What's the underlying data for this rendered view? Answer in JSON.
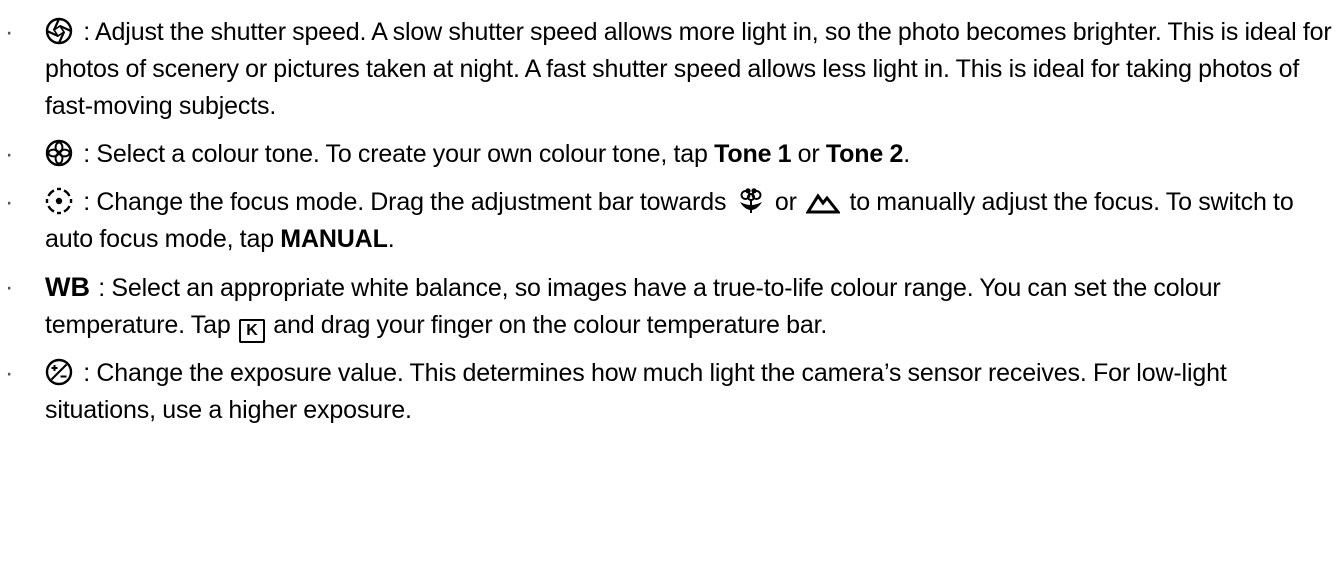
{
  "items": [
    {
      "icon": "shutter-speed-icon",
      "text": " : Adjust the shutter speed. A slow shutter speed allows more light in, so the photo becomes brighter. This is ideal for photos of scenery or pictures taken at night. A fast shutter speed allows less light in. This is ideal for taking photos of fast-moving subjects."
    },
    {
      "icon": "colour-tone-icon",
      "text_a": " : Select a colour tone. To create your own colour tone, tap ",
      "bold_a": "Tone 1",
      "text_b": " or ",
      "bold_b": "Tone 2",
      "text_c": "."
    },
    {
      "icon": "focus-mode-icon",
      "text_a": " : Change the focus mode. Drag the adjustment bar towards ",
      "macro_icon": "macro-flower-icon",
      "text_b": " or ",
      "landscape_icon": "mountain-icon",
      "text_c": " to manually adjust the focus. To switch to auto focus mode, tap ",
      "bold_a": "MANUAL",
      "text_d": "."
    },
    {
      "icon_label": "WB",
      "text_a": " : Select an appropriate white balance, so images have a true-to-life colour range. You can set the colour temperature. Tap ",
      "key_label": "K",
      "text_b": " and drag your finger on the colour temperature bar."
    },
    {
      "icon": "exposure-value-icon",
      "text": " : Change the exposure value. This determines how much light the camera’s sensor receives. For low-light situations, use a higher exposure."
    }
  ],
  "bullet": "·"
}
